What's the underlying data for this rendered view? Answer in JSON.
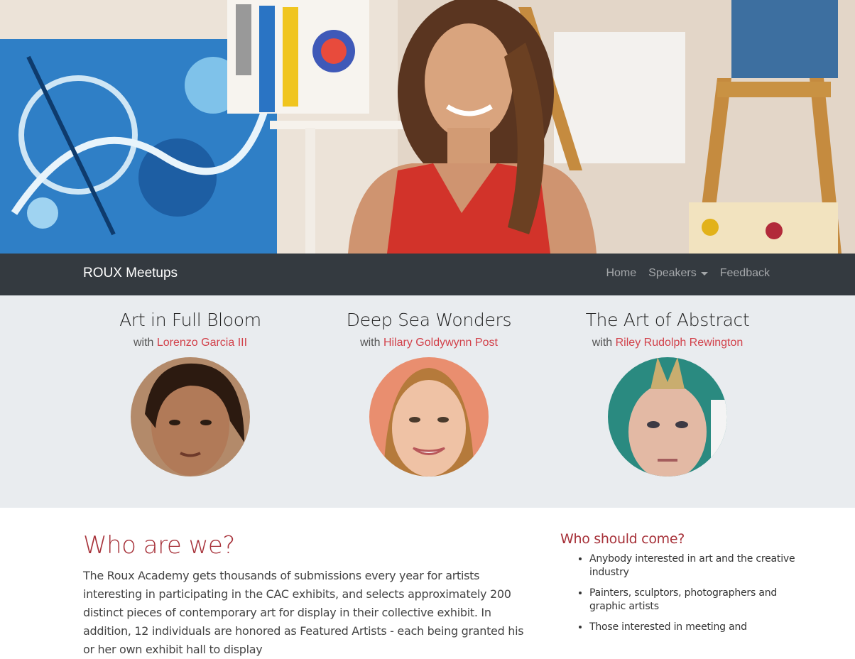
{
  "nav": {
    "brand": "ROUX Meetups",
    "links": [
      {
        "label": "Home"
      },
      {
        "label": "Speakers"
      },
      {
        "label": "Feedback"
      }
    ]
  },
  "speakers": [
    {
      "title": "Art in Full Bloom",
      "with": "with",
      "name": "Lorenzo Garcia III"
    },
    {
      "title": "Deep Sea Wonders",
      "with": "with",
      "name": "Hilary Goldywynn Post"
    },
    {
      "title": "The Art of Abstract",
      "with": "with",
      "name": "Riley Rudolph Rewington"
    }
  ],
  "about": {
    "title": "Who are we?",
    "text": "The Roux Academy gets thousands of submissions every year for artists interesting in participating in the CAC exhibits, and selects approximately 200 distinct pieces of contemporary art for display in their collective exhibit. In addition, 12 individuals are honored as Featured Artists - each being granted his or her own exhibit hall to display"
  },
  "sidebar": {
    "title": "Who should come?",
    "items": [
      "Anybody interested in art and the creative industry",
      "Painters, sculptors, photographers and graphic artists",
      "Those interested in meeting and"
    ]
  },
  "colors": {
    "navbar_bg": "#343a40",
    "accent": "#a7323a",
    "link": "#d2424b",
    "strip_bg": "#e9ecef"
  }
}
